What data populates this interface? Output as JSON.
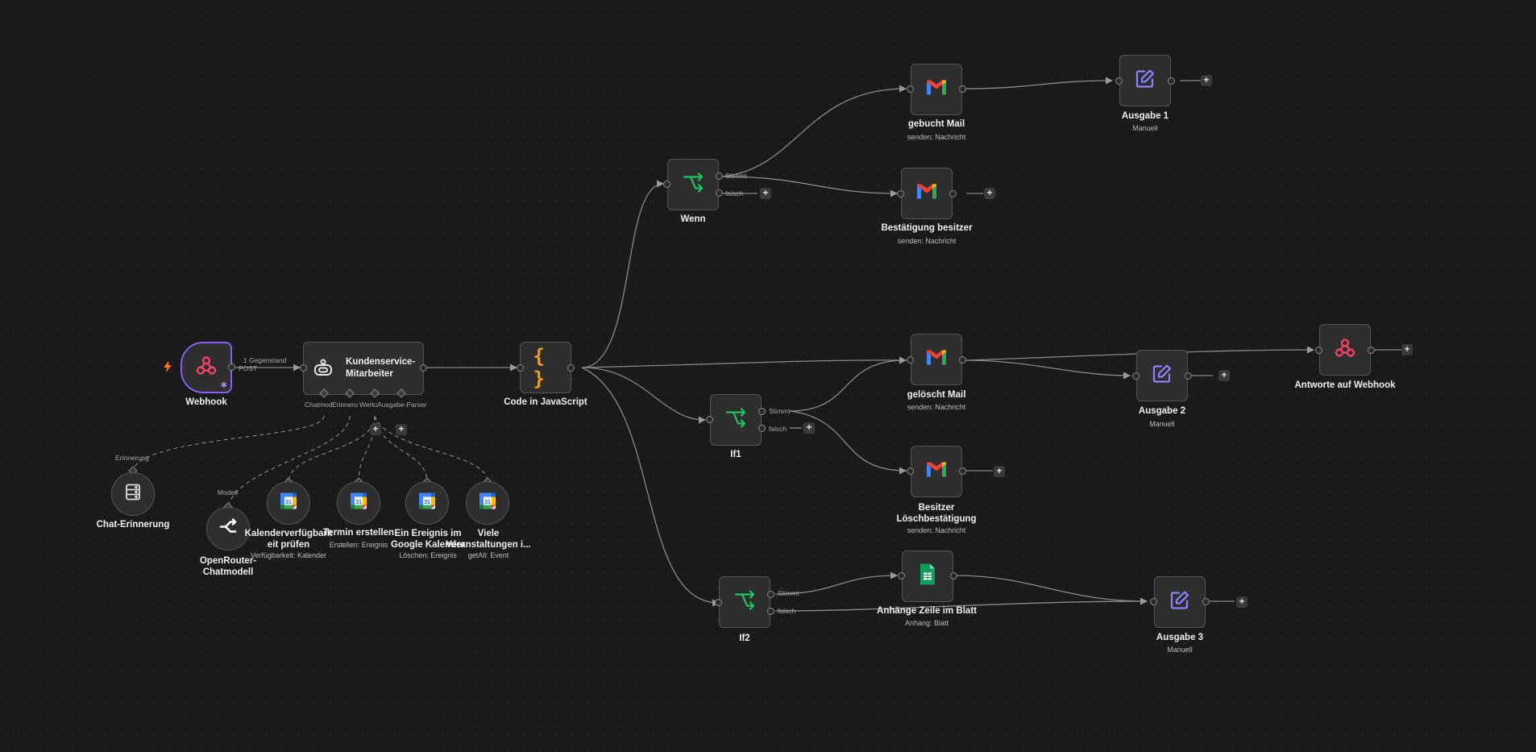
{
  "edge_labels": {
    "items_count": "1 Gegenstand",
    "method": "POST"
  },
  "nodes": {
    "webhook": {
      "title": "Webhook",
      "icon": "webhook-icon"
    },
    "agent": {
      "title": "Kundenservice-\nMitarbeiter",
      "icon": "robot-icon",
      "ports": [
        "Chatmodell",
        "Erinnerung",
        "Werkzeug",
        "Ausgabe-Parser"
      ]
    },
    "code": {
      "title": "Code in JavaScript",
      "icon": "code-braces-icon"
    },
    "wenn": {
      "title": "Wenn",
      "true_label": "Stimmt",
      "false_label": "falsch"
    },
    "if1": {
      "title": "If1",
      "true_label": "Stimmt",
      "false_label": "falsch"
    },
    "if2": {
      "title": "If2",
      "true_label": "Stimmt",
      "false_label": "falsch"
    },
    "gebucht": {
      "title": "gebucht Mail",
      "sub": "senden: Nachricht"
    },
    "bestaetigung": {
      "title": "Bestätigung besitzer",
      "sub": "senden: Nachricht"
    },
    "geloescht": {
      "title": "gelöscht Mail",
      "sub": "senden: Nachricht"
    },
    "besitzer_loesch": {
      "title": "Besitzer\nLöschbestätigung",
      "sub": "senden: Nachricht"
    },
    "sheets": {
      "title": "Anhänge Zeile im Blatt",
      "sub": "Anhang: Blatt"
    },
    "ausgabe1": {
      "title": "Ausgabe 1",
      "sub": "Manuell"
    },
    "ausgabe2": {
      "title": "Ausgabe 2",
      "sub": "Manuell"
    },
    "ausgabe3": {
      "title": "Ausgabe 3",
      "sub": "Manuell"
    },
    "antworte": {
      "title": "Antworte auf Webhook"
    },
    "chat_mem": {
      "title": "Chat-Erinnerung",
      "port_label": "Erinnerung"
    },
    "openrouter": {
      "title": "OpenRouter-\nChatmodell",
      "port_label": "Modell"
    },
    "cal1": {
      "title": "Kalenderverfügbark\neit prüfen",
      "sub": "Verfügbarkeit: Kalender"
    },
    "cal2": {
      "title": "Termin erstellen",
      "sub": "Erstellen: Ereignis"
    },
    "cal3": {
      "title": "Ein Ereignis im\nGoogle Kalender",
      "sub": "Löschen: Ereignis"
    },
    "cal4": {
      "title": "Viele\nVeranstaltungen i...",
      "sub": "getAll: Event"
    }
  },
  "colors": {
    "background": "#1a1a1a",
    "node_bg": "#2e2e2e",
    "edge": "#8a8a8a",
    "webhook_accent": "#8b5cf6",
    "if_green": "#22c55e",
    "code_orange": "#f59e0b",
    "edit_purple": "#8b83ff",
    "webhook_pink": "#ef4466",
    "trigger_orange": "#f97316"
  }
}
